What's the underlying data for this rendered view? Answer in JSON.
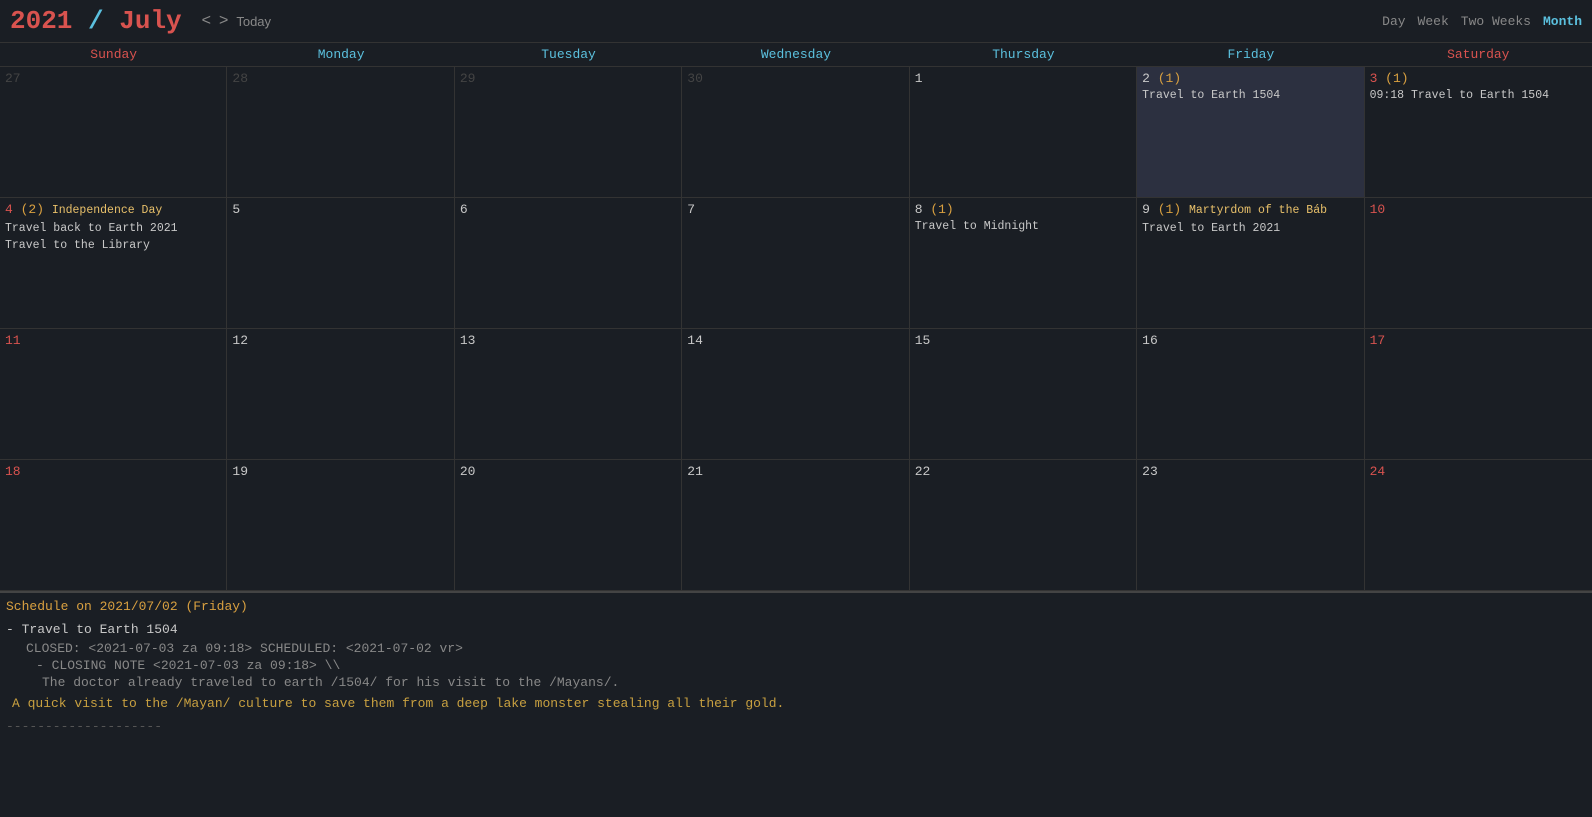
{
  "header": {
    "year": "2021",
    "separator": " / ",
    "month": "July",
    "nav_prev": "<",
    "nav_next": ">",
    "today_label": "Today",
    "views": [
      "Day",
      "Week",
      "Two Weeks",
      "Month"
    ],
    "active_view": "Month"
  },
  "day_headers": [
    {
      "label": "Sunday",
      "type": "sunday"
    },
    {
      "label": "Monday",
      "type": "weekday"
    },
    {
      "label": "Tuesday",
      "type": "weekday"
    },
    {
      "label": "Wednesday",
      "type": "weekday"
    },
    {
      "label": "Thursday",
      "type": "weekday"
    },
    {
      "label": "Friday",
      "type": "weekday"
    },
    {
      "label": "Saturday",
      "type": "saturday"
    }
  ],
  "weeks": [
    {
      "days": [
        {
          "num": "27",
          "type": "sunday",
          "other": true,
          "events": []
        },
        {
          "num": "28",
          "type": "weekday",
          "other": true,
          "events": []
        },
        {
          "num": "29",
          "type": "weekday",
          "other": true,
          "events": []
        },
        {
          "num": "30",
          "type": "weekday",
          "other": true,
          "events": []
        },
        {
          "num": "1",
          "type": "weekday",
          "other": false,
          "events": []
        },
        {
          "num": "2",
          "type": "weekday",
          "other": false,
          "today": true,
          "count": "(1)",
          "events": [
            {
              "text": "Travel to Earth 1504",
              "cls": "travel"
            }
          ]
        },
        {
          "num": "3",
          "type": "saturday",
          "other": false,
          "count": "(1)",
          "events": [
            {
              "text": "09:18 Travel to Earth 1504",
              "cls": "travel-time"
            }
          ]
        }
      ]
    },
    {
      "days": [
        {
          "num": "4",
          "type": "sunday",
          "other": false,
          "count": "(2)",
          "events": [
            {
              "text": "Independence Day",
              "cls": "holiday"
            },
            {
              "text": "Travel back to Earth 2021",
              "cls": "travel"
            },
            {
              "text": "Travel to the Library",
              "cls": "travel"
            }
          ]
        },
        {
          "num": "5",
          "type": "weekday",
          "other": false,
          "events": []
        },
        {
          "num": "6",
          "type": "weekday",
          "other": false,
          "events": []
        },
        {
          "num": "7",
          "type": "weekday",
          "other": false,
          "events": []
        },
        {
          "num": "8",
          "type": "weekday",
          "other": false,
          "count": "(1)",
          "events": [
            {
              "text": "Travel to Midnight",
              "cls": "travel"
            }
          ]
        },
        {
          "num": "9",
          "type": "weekday",
          "other": false,
          "count": "(1)",
          "events": [
            {
              "text": "Martyrdom of the Báb",
              "cls": "holiday"
            },
            {
              "text": "Travel to Earth 2021",
              "cls": "travel"
            }
          ]
        },
        {
          "num": "10",
          "type": "saturday",
          "other": false,
          "events": []
        }
      ]
    },
    {
      "days": [
        {
          "num": "11",
          "type": "sunday",
          "other": false,
          "events": []
        },
        {
          "num": "12",
          "type": "weekday",
          "other": false,
          "events": []
        },
        {
          "num": "13",
          "type": "weekday",
          "other": false,
          "events": []
        },
        {
          "num": "14",
          "type": "weekday",
          "other": false,
          "events": []
        },
        {
          "num": "15",
          "type": "weekday",
          "other": false,
          "events": []
        },
        {
          "num": "16",
          "type": "weekday",
          "other": false,
          "events": []
        },
        {
          "num": "17",
          "type": "saturday",
          "other": false,
          "events": []
        }
      ]
    },
    {
      "days": [
        {
          "num": "18",
          "type": "sunday",
          "other": false,
          "events": []
        },
        {
          "num": "19",
          "type": "weekday",
          "other": false,
          "events": []
        },
        {
          "num": "20",
          "type": "weekday",
          "other": false,
          "events": []
        },
        {
          "num": "21",
          "type": "weekday",
          "other": false,
          "events": []
        },
        {
          "num": "22",
          "type": "weekday",
          "other": false,
          "events": []
        },
        {
          "num": "23",
          "type": "weekday",
          "other": false,
          "events": []
        },
        {
          "num": "24",
          "type": "saturday",
          "other": false,
          "events": []
        }
      ]
    }
  ],
  "schedule": {
    "date_label": "Schedule on 2021/07/02",
    "day_label": "(Friday)",
    "item": {
      "title": "- Travel to Earth 1504",
      "closed": "CLOSED: <2021-07-03 za 09:18> SCHEDULED: <2021-07-02 vr>",
      "closing_note_label": "- CLOSING NOTE <2021-07-03 za 09:18> \\\\",
      "closing_note_line1": "The doctor already traveled to earth /1504/ for his visit to the /Mayans/.",
      "desc": "A quick visit to the /Mayan/ culture to save them from a deep lake monster stealing all their gold.",
      "divider": "--------------------"
    }
  }
}
